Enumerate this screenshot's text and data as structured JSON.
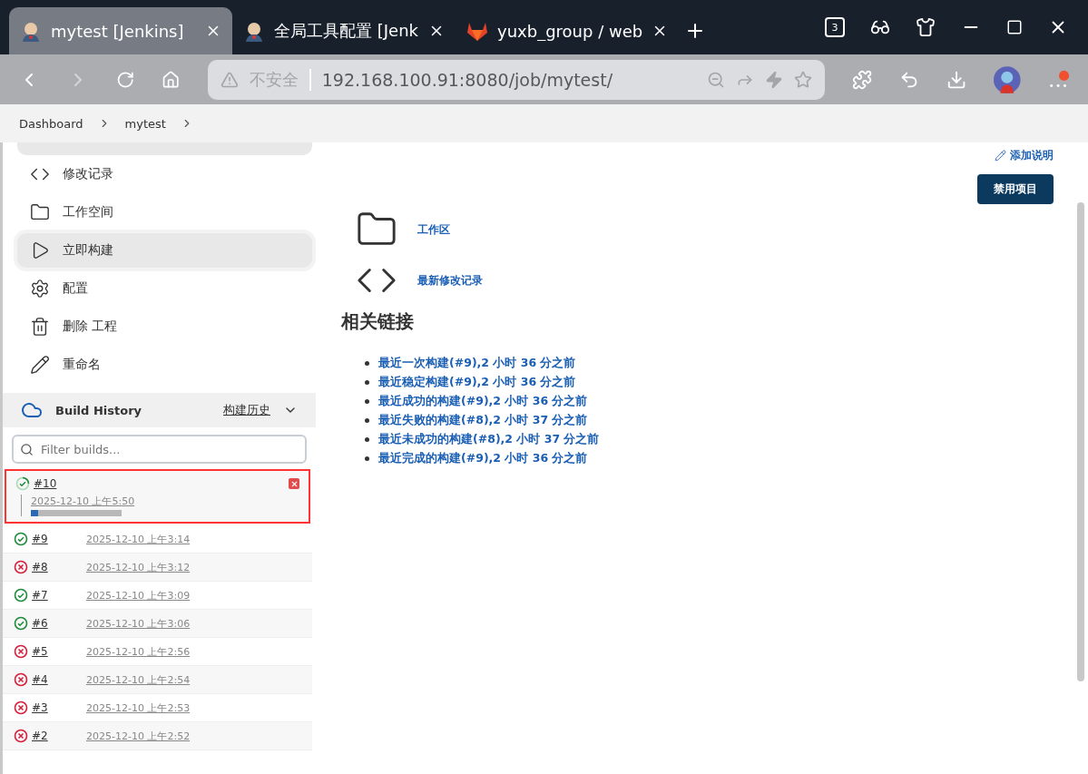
{
  "browser": {
    "tabs": [
      {
        "title": "mytest [Jenkins]",
        "kind": "jenkins",
        "selected": true
      },
      {
        "title": "全局工具配置 [Jenk",
        "kind": "jenkins",
        "selected": false
      },
      {
        "title": "yuxb_group / web",
        "kind": "gitlab",
        "selected": false
      }
    ],
    "tab_count": "3",
    "address": {
      "security": "不安全",
      "url": "192.168.100.91:8080/job/mytest/"
    }
  },
  "breadcrumb": [
    "Dashboard",
    "mytest"
  ],
  "sidebar": {
    "items": [
      {
        "label": "修改记录",
        "kind": "code",
        "selected": false
      },
      {
        "label": "工作空间",
        "kind": "folder",
        "selected": false
      },
      {
        "label": "立即构建",
        "kind": "play",
        "selected": true
      },
      {
        "label": "配置",
        "kind": "gear",
        "selected": false
      },
      {
        "label": "删除 工程",
        "kind": "trash",
        "selected": false
      },
      {
        "label": "重命名",
        "kind": "pencil",
        "selected": false
      }
    ]
  },
  "build_history": {
    "title": "Build History",
    "link": "构建历史",
    "filter": {
      "placeholder": "Filter builds..."
    },
    "builds": [
      {
        "number": "#10",
        "time": "2025-12-10 上午5:50",
        "kind": "running",
        "level": 0.08,
        "highlighted": true
      },
      {
        "number": "#9",
        "time": "2025-12-10 上午3:14",
        "kind": "success",
        "highlighted": false
      },
      {
        "number": "#8",
        "time": "2025-12-10 上午3:12",
        "kind": "failure",
        "highlighted": false
      },
      {
        "number": "#7",
        "time": "2025-12-10 上午3:09",
        "kind": "success",
        "highlighted": false
      },
      {
        "number": "#6",
        "time": "2025-12-10 上午3:06",
        "kind": "success",
        "highlighted": false
      },
      {
        "number": "#5",
        "time": "2025-12-10 上午2:56",
        "kind": "failure",
        "highlighted": false
      },
      {
        "number": "#4",
        "time": "2025-12-10 上午2:54",
        "kind": "failure",
        "highlighted": false
      },
      {
        "number": "#3",
        "time": "2025-12-10 上午2:53",
        "kind": "failure",
        "highlighted": false
      },
      {
        "number": "#2",
        "time": "2025-12-10 上午2:52",
        "kind": "failure",
        "highlighted": false
      }
    ]
  },
  "main": {
    "add_description": "添加说明",
    "disable_button": "禁用项目",
    "shortcuts": [
      {
        "label": "工作区",
        "kind": "folder"
      },
      {
        "label": "最新修改记录",
        "kind": "code"
      }
    ],
    "related_heading": "相关链接",
    "related_links": [
      "最近一次构建(#9),2 小时 36 分之前",
      "最近稳定构建(#9),2 小时 36 分之前",
      "最近成功的构建(#9),2 小时 36 分之前",
      "最近失败的构建(#8),2 小时 37 分之前",
      "最近未成功的构建(#8),2 小时 37 分之前",
      "最近完成的构建(#9),2 小时 36 分之前"
    ]
  }
}
